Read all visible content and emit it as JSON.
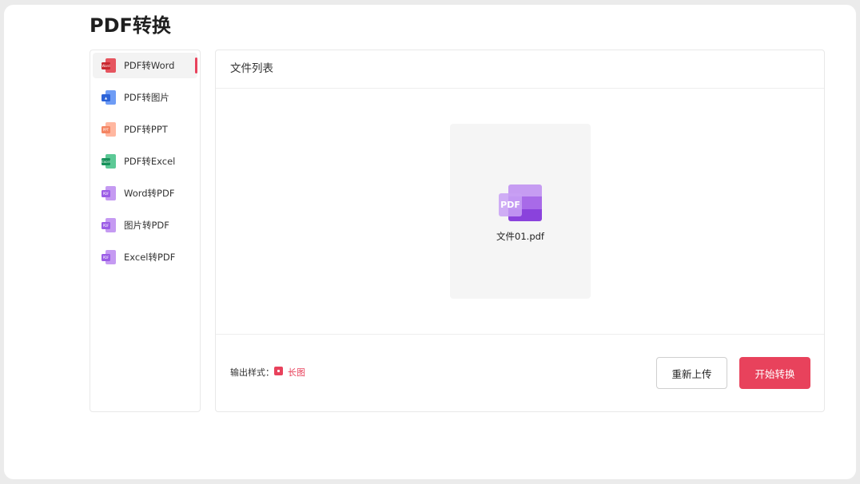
{
  "page": {
    "title": "PDF转换"
  },
  "sidebar": {
    "items": [
      {
        "label": "PDF转Word",
        "icon": "pdf-to-word-icon",
        "badge": "Word",
        "back": "#e6555f",
        "front": "#c9282f",
        "active": true
      },
      {
        "label": "PDF转图片",
        "icon": "pdf-to-image-icon",
        "badge": "▲",
        "back": "#6e9cf5",
        "front": "#2c63d8",
        "active": false
      },
      {
        "label": "PDF转PPT",
        "icon": "pdf-to-ppt-icon",
        "badge": "PPT",
        "back": "#ffb7a0",
        "front": "#f48462",
        "active": false
      },
      {
        "label": "PDF转Excel",
        "icon": "pdf-to-excel-icon",
        "badge": "Excel",
        "back": "#5cc996",
        "front": "#17915a",
        "active": false
      },
      {
        "label": "Word转PDF",
        "icon": "word-to-pdf-icon",
        "badge": "PDF",
        "back": "#c59af2",
        "front": "#9b5ce6",
        "active": false
      },
      {
        "label": "图片转PDF",
        "icon": "image-to-pdf-icon",
        "badge": "PDF",
        "back": "#c59af2",
        "front": "#9b5ce6",
        "active": false
      },
      {
        "label": "Excel转PDF",
        "icon": "excel-to-pdf-icon",
        "badge": "PDF",
        "back": "#c59af2",
        "front": "#9b5ce6",
        "active": false
      }
    ]
  },
  "main": {
    "header": "文件列表",
    "file": {
      "name": "文件01.pdf",
      "icon_label": "PDF",
      "icon": "pdf-file-icon"
    },
    "footer": {
      "output_label": "输出样式：",
      "output_value": "长图",
      "reupload_label": "重新上传",
      "start_label": "开始转换"
    }
  },
  "colors": {
    "accent": "#e8425c",
    "border": "#e8e8e8",
    "card": "#f5f5f5"
  }
}
